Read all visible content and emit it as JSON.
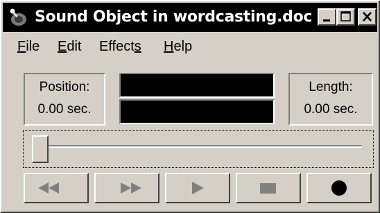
{
  "window": {
    "title": "Sound Object in wordcasting.doc",
    "app_icon": "sound-recorder-icon",
    "title_bar_buttons": [
      "minimize-icon",
      "maximize-icon",
      "close-icon"
    ]
  },
  "menu": {
    "file": {
      "accel": "F",
      "rest": "ile"
    },
    "edit": {
      "accel": "E",
      "rest": "dit"
    },
    "effects": {
      "pre": "Effect",
      "accel": "s"
    },
    "help": {
      "accel": "H",
      "rest": "elp"
    }
  },
  "position": {
    "label": "Position:",
    "value": "0.00 sec."
  },
  "length": {
    "label": "Length:",
    "value": "0.00 sec."
  },
  "slider": {
    "value_fraction": 0
  },
  "transport": {
    "buttons": [
      "seek-to-start-icon",
      "seek-to-end-icon",
      "play-icon",
      "stop-icon",
      "record-icon"
    ]
  },
  "colors": {
    "face": "#d4d0c8",
    "title_bar": "#000000",
    "display": "#000000"
  }
}
